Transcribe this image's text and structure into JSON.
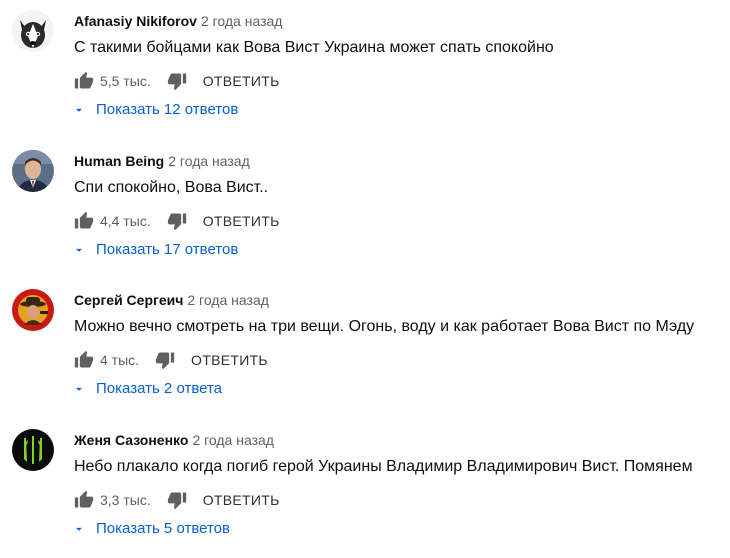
{
  "colors": {
    "link": "#065fd4",
    "meta": "#606060",
    "text": "#0f0f0f"
  },
  "icons": {
    "like": "thumb-up-icon",
    "dislike": "thumb-down-icon",
    "expand": "chevron-down-icon"
  },
  "comments": [
    {
      "author": "Afanasiy Nikiforov",
      "time": "2 года назад",
      "text": "С такими бойцами как Вова Вист Украина может спать спокойно",
      "likes": "5,5 тыс.",
      "reply": "ОТВЕТИТЬ",
      "replies": "Показать 12 ответов"
    },
    {
      "author": "Human Being",
      "time": "2 года назад",
      "text": "Спи спокойно, Вова Вист..",
      "likes": "4,4 тыс.",
      "reply": "ОТВЕТИТЬ",
      "replies": "Показать 17 ответов"
    },
    {
      "author": "Сергей Сергеич",
      "time": "2 года назад",
      "text": "Можно вечно смотреть на три вещи. Огонь, воду и как работает Вова Вист по Мэду",
      "likes": "4 тыс.",
      "reply": "ОТВЕТИТЬ",
      "replies": "Показать 2 ответа"
    },
    {
      "author": "Женя Сазоненко",
      "time": "2 года назад",
      "text": "Небо плакало когда погиб герой Украины Владимир Владимирович Вист. Помянем",
      "likes": "3,3 тыс.",
      "reply": "ОТВЕТИТЬ",
      "replies": "Показать 5 ответов"
    }
  ]
}
